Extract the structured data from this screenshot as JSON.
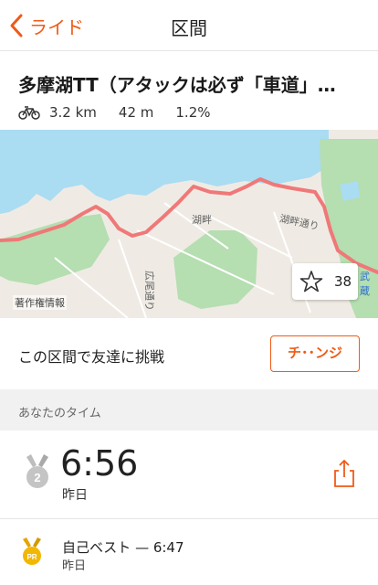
{
  "navbar": {
    "back_label": "ライド",
    "title": "区間"
  },
  "segment": {
    "name": "多摩湖TT（アタックは必ず「車道」…",
    "distance": "3.2 km",
    "elevation": "42 m",
    "grade": "1.2%"
  },
  "map": {
    "labels": {
      "kohan": "湖畔",
      "kohan_dori": "湖畔通り",
      "hiroo": "広尾通り",
      "musashi": "武蔵"
    },
    "credit": "著作権情報",
    "star_count": "38",
    "route_color": "#f07878",
    "water_color": "#aadcf2",
    "park_color": "#b5deb1"
  },
  "challenge": {
    "text": "この区間で友達に挑戦",
    "button_label": "チ･･ンジ"
  },
  "your_time": {
    "section_title": "あなたのタイム",
    "rank": "2",
    "time": "6:56",
    "date": "昨日"
  },
  "personal_best": {
    "badge": "PR",
    "label": "自己ベスト — 6:47",
    "date": "昨日"
  },
  "colors": {
    "accent": "#f05a16",
    "pr_gold": "#f2b705"
  }
}
